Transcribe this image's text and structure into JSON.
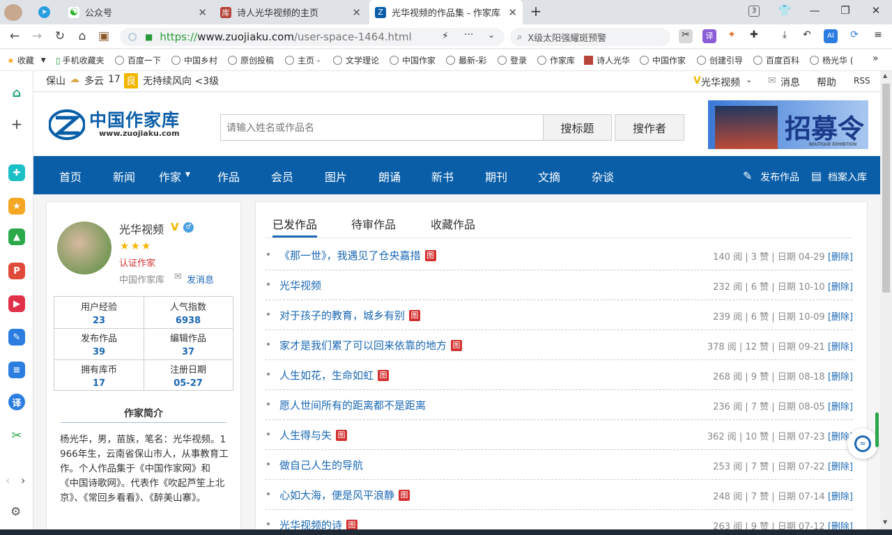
{
  "browser": {
    "tabs": [
      {
        "label": "公众号",
        "active": false
      },
      {
        "label": "诗人光华视频的主页",
        "active": false
      },
      {
        "label": "光华视频的作品集 - 作家库",
        "active": true
      }
    ],
    "tab_count": "3",
    "url": {
      "scheme": "https://",
      "domain": "www.zuojiaku.com",
      "path": "/user-space-1464.html"
    },
    "search_text": "X级太阳强耀斑预警",
    "bookmarks": [
      "收藏",
      "手机收藏夹",
      "百度一下",
      "中国乡村",
      "原创投稿",
      "主页 -",
      "文学理论",
      "中国作家",
      "最新-彩",
      "登录",
      "作家库",
      "诗人光华",
      "中国作家",
      "创建引导",
      "百度百科",
      "杨光华 ("
    ],
    "more_bookmarks": "»",
    "colors": {
      "accent": "#0a5ea8",
      "link": "#1a67b3",
      "author_red": "#d32f2f"
    }
  },
  "topbar": {
    "weather": "保山",
    "condition": "多云",
    "temp": "17",
    "aqi": "良",
    "wind": "无持续风向 <3级",
    "user": "光华视频",
    "messages": "消息",
    "help": "帮助",
    "rss": "RSS"
  },
  "header": {
    "logo_title": "中国作家库",
    "logo_url": "www.zuojiaku.com",
    "search_placeholder": "请输入姓名或作品名",
    "search_title_btn": "搜标题",
    "search_author_btn": "搜作者",
    "banner_text": "招募令",
    "banner_sub": "BOUTIQUE EXHIBITION"
  },
  "nav": {
    "items": [
      "首页",
      "新闻",
      "作家",
      "作品",
      "会员",
      "图片",
      "朗诵",
      "新书",
      "期刊",
      "文摘",
      "杂谈"
    ],
    "publish": "发布作品",
    "archive": "档案入库"
  },
  "profile": {
    "name": "光华视频",
    "stars": "★★★",
    "certified": "认证作家",
    "site": "中国作家库",
    "send_msg": "发消息",
    "stats": [
      {
        "label": "用户经验",
        "value": "23"
      },
      {
        "label": "人气指数",
        "value": "6938"
      },
      {
        "label": "发布作品",
        "value": "39"
      },
      {
        "label": "编辑作品",
        "value": "37"
      },
      {
        "label": "拥有库币",
        "value": "17"
      },
      {
        "label": "注册日期",
        "value": "05-27"
      }
    ],
    "intro_title": "作家简介",
    "intro_text": "杨光华，男，苗族，笔名：光华视频。1966年生，云南省保山市人，从事教育工作。个人作品集于《中国作家网》和《中国诗歌网》。代表作《吹起芦笙上北京》、《常回乡看看》、《醉美山寨》。"
  },
  "works": {
    "tabs": [
      "已发作品",
      "待审作品",
      "收藏作品"
    ],
    "image_tag": "图",
    "list": [
      {
        "title": "《那一世》，我遇见了仓央嘉措",
        "img": true,
        "reads": "140",
        "likes": "3",
        "date": "04-29"
      },
      {
        "title": "光华视频",
        "img": false,
        "reads": "232",
        "likes": "6",
        "date": "10-10"
      },
      {
        "title": "对于孩子的教育，城乡有别",
        "img": true,
        "reads": "239",
        "likes": "6",
        "date": "10-09"
      },
      {
        "title": "家才是我们累了可以回来依靠的地方",
        "img": true,
        "reads": "378",
        "likes": "12",
        "date": "09-21"
      },
      {
        "title": "人生如花，生命如虹",
        "img": true,
        "reads": "268",
        "likes": "9",
        "date": "08-18"
      },
      {
        "title": "愿人世间所有的距离都不是距离",
        "img": false,
        "reads": "236",
        "likes": "7",
        "date": "08-05"
      },
      {
        "title": "人生得与失",
        "img": true,
        "reads": "362",
        "likes": "10",
        "date": "07-23"
      },
      {
        "title": "做自己人生的导航",
        "img": false,
        "reads": "253",
        "likes": "7",
        "date": "07-22"
      },
      {
        "title": "心如大海，便是风平浪静",
        "img": true,
        "reads": "248",
        "likes": "7",
        "date": "07-14"
      },
      {
        "title": "光华视频的诗",
        "img": true,
        "reads": "263",
        "likes": "9",
        "date": "07-12"
      }
    ],
    "meta_reads_suffix": " 阅 | ",
    "meta_likes_suffix": " 赞 | 日期 ",
    "delete_label": "[删除]"
  }
}
